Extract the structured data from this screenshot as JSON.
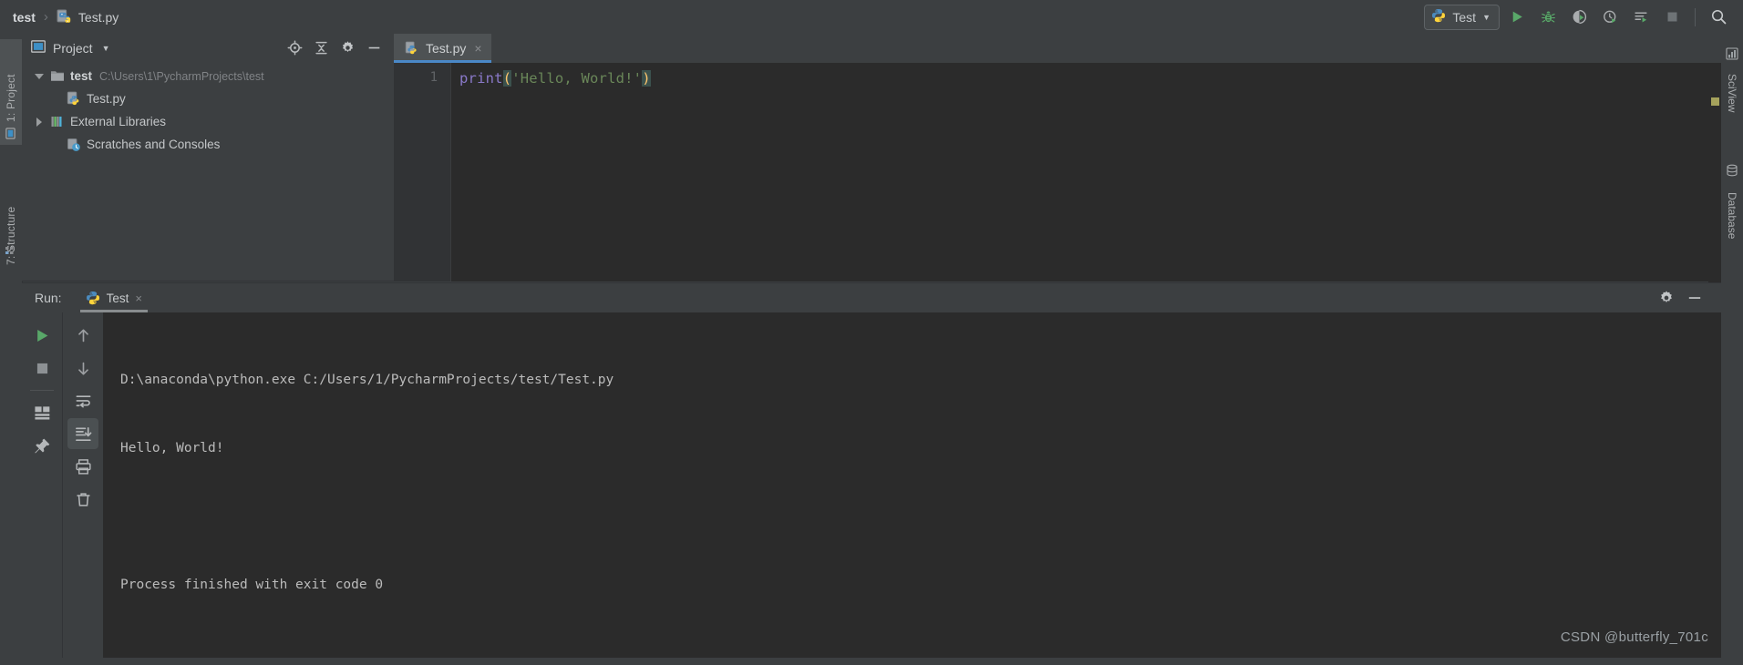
{
  "topbar": {
    "breadcrumb": [
      {
        "label": "test",
        "icon": "folder-icon"
      },
      {
        "label": "Test.py",
        "icon": "python-file-icon"
      }
    ],
    "separator": "›",
    "run_config": {
      "label": "Test",
      "icon": "python-icon",
      "dropdown": "▼"
    },
    "actions": [
      {
        "name": "run-button",
        "tip": "Run"
      },
      {
        "name": "debug-button",
        "tip": "Debug"
      },
      {
        "name": "run-coverage-button",
        "tip": "Run with Coverage"
      },
      {
        "name": "profile-button",
        "tip": "Profile"
      },
      {
        "name": "run-with-params-button",
        "tip": "Run with Parameters"
      },
      {
        "name": "stop-button",
        "tip": "Stop"
      },
      {
        "name": "search-button",
        "tip": "Search Everywhere"
      }
    ]
  },
  "left_strip": {
    "tabs": [
      {
        "label": "1: Project",
        "icon": "project-icon",
        "selected": true
      },
      {
        "label": "7: Structure",
        "icon": "structure-icon",
        "selected": false
      }
    ]
  },
  "right_strip": {
    "tabs": [
      {
        "label": "SciView",
        "icon": "sciview-icon"
      },
      {
        "label": "Database",
        "icon": "database-icon"
      }
    ]
  },
  "project_panel": {
    "title": "Project",
    "title_dropdown": "▼",
    "header_icons": [
      {
        "name": "locate-icon"
      },
      {
        "name": "collapse-all-icon"
      },
      {
        "name": "settings-gear-icon"
      },
      {
        "name": "hide-icon"
      }
    ],
    "tree": [
      {
        "label": "test",
        "sublabel": "C:\\Users\\1\\PycharmProjects\\test",
        "icon": "folder-icon",
        "arrow": "down",
        "indent": 0,
        "bold": true
      },
      {
        "label": "Test.py",
        "sublabel": "",
        "icon": "python-file-icon",
        "arrow": "none",
        "indent": 1,
        "bold": false
      },
      {
        "label": "External Libraries",
        "sublabel": "",
        "icon": "libraries-icon",
        "arrow": "right",
        "indent": 0,
        "bold": false
      },
      {
        "label": "Scratches and Consoles",
        "sublabel": "",
        "icon": "scratches-icon",
        "arrow": "none",
        "indent": 0,
        "bold": false
      }
    ]
  },
  "editor": {
    "tab": {
      "label": "Test.py",
      "icon": "python-file-icon",
      "close": "×",
      "active": true
    },
    "line_number": "1",
    "code": {
      "fn": "print",
      "open_paren": "(",
      "string": "'Hello, World!'",
      "close_paren": ")"
    }
  },
  "run_panel": {
    "label": "Run:",
    "tab": {
      "label": "Test",
      "icon": "python-icon",
      "close": "×"
    },
    "header_icons": [
      {
        "name": "settings-gear-icon"
      },
      {
        "name": "hide-icon"
      }
    ],
    "toolbar_left": [
      {
        "name": "rerun-button",
        "icon": "play-icon"
      },
      {
        "name": "stop-button",
        "icon": "stop-square-icon"
      },
      {
        "name": "layout-button",
        "icon": "layout-icon"
      },
      {
        "name": "pin-tab-button",
        "icon": "pin-icon"
      }
    ],
    "toolbar_right": [
      {
        "name": "prev-occurrence-button",
        "icon": "arrow-up-icon"
      },
      {
        "name": "next-occurrence-button",
        "icon": "arrow-down-icon"
      },
      {
        "name": "soft-wrap-button",
        "icon": "soft-wrap-icon"
      },
      {
        "name": "scroll-to-end-button",
        "icon": "scroll-end-icon"
      },
      {
        "name": "print-button",
        "icon": "printer-icon"
      },
      {
        "name": "clear-all-button",
        "icon": "trash-icon"
      }
    ],
    "console_lines": [
      "D:\\anaconda\\python.exe C:/Users/1/PycharmProjects/test/Test.py",
      "Hello, World!",
      "",
      "Process finished with exit code 0"
    ]
  },
  "watermark": "CSDN @butterfly_701c",
  "colors": {
    "background": "#3c3f41",
    "editor_background": "#2b2b2b",
    "accent_blue": "#4a88c7",
    "run_green": "#499c54",
    "string_green": "#6a8759",
    "keyword_purple": "#8a79c9"
  }
}
